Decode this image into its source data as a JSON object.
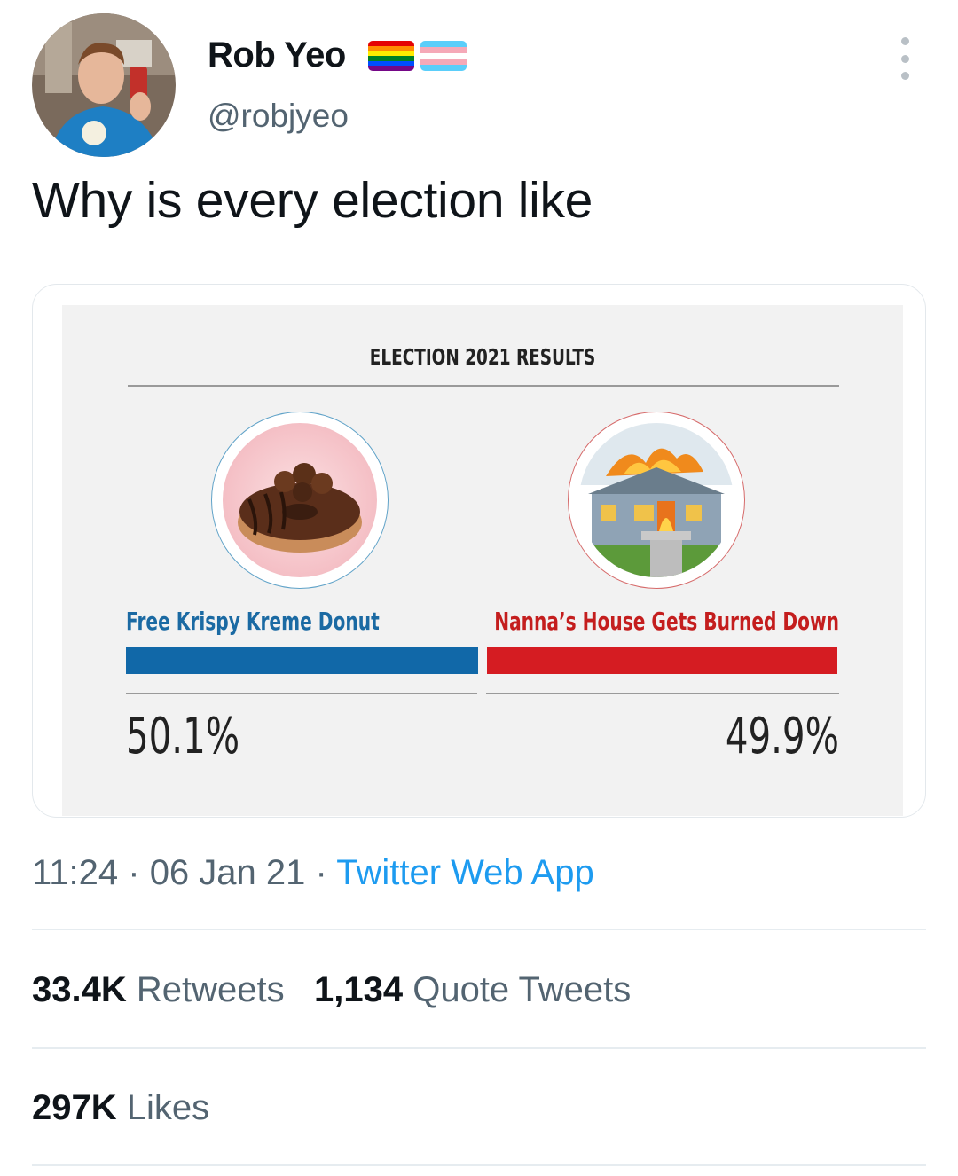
{
  "author": {
    "display_name": "Rob Yeo",
    "handle": "@robjyeo"
  },
  "tweet": {
    "text": "Why is every election like"
  },
  "graphic": {
    "title": "ELECTION 2021 RESULTS",
    "left_option": "Free Krispy Kreme Donut",
    "right_option": "Nanna’s House Gets Burned Down",
    "left_percent_label": "50.1%",
    "right_percent_label": "49.9%",
    "left_share": 50.1,
    "right_share": 49.9,
    "colors": {
      "left": "#1168a8",
      "right": "#d51c22"
    }
  },
  "meta": {
    "time": "11:24",
    "separator": " · ",
    "date": "06 Jan 21",
    "source": "Twitter Web App"
  },
  "stats": {
    "retweets_count": "33.4K",
    "retweets_label": "Retweets",
    "quotes_count": "1,134",
    "quotes_label": "Quote Tweets",
    "likes_count": "297K",
    "likes_label": "Likes"
  },
  "icons": {
    "more": "more-options-icon",
    "flags": [
      "rainbow-flag-icon",
      "transgender-flag-icon"
    ]
  }
}
